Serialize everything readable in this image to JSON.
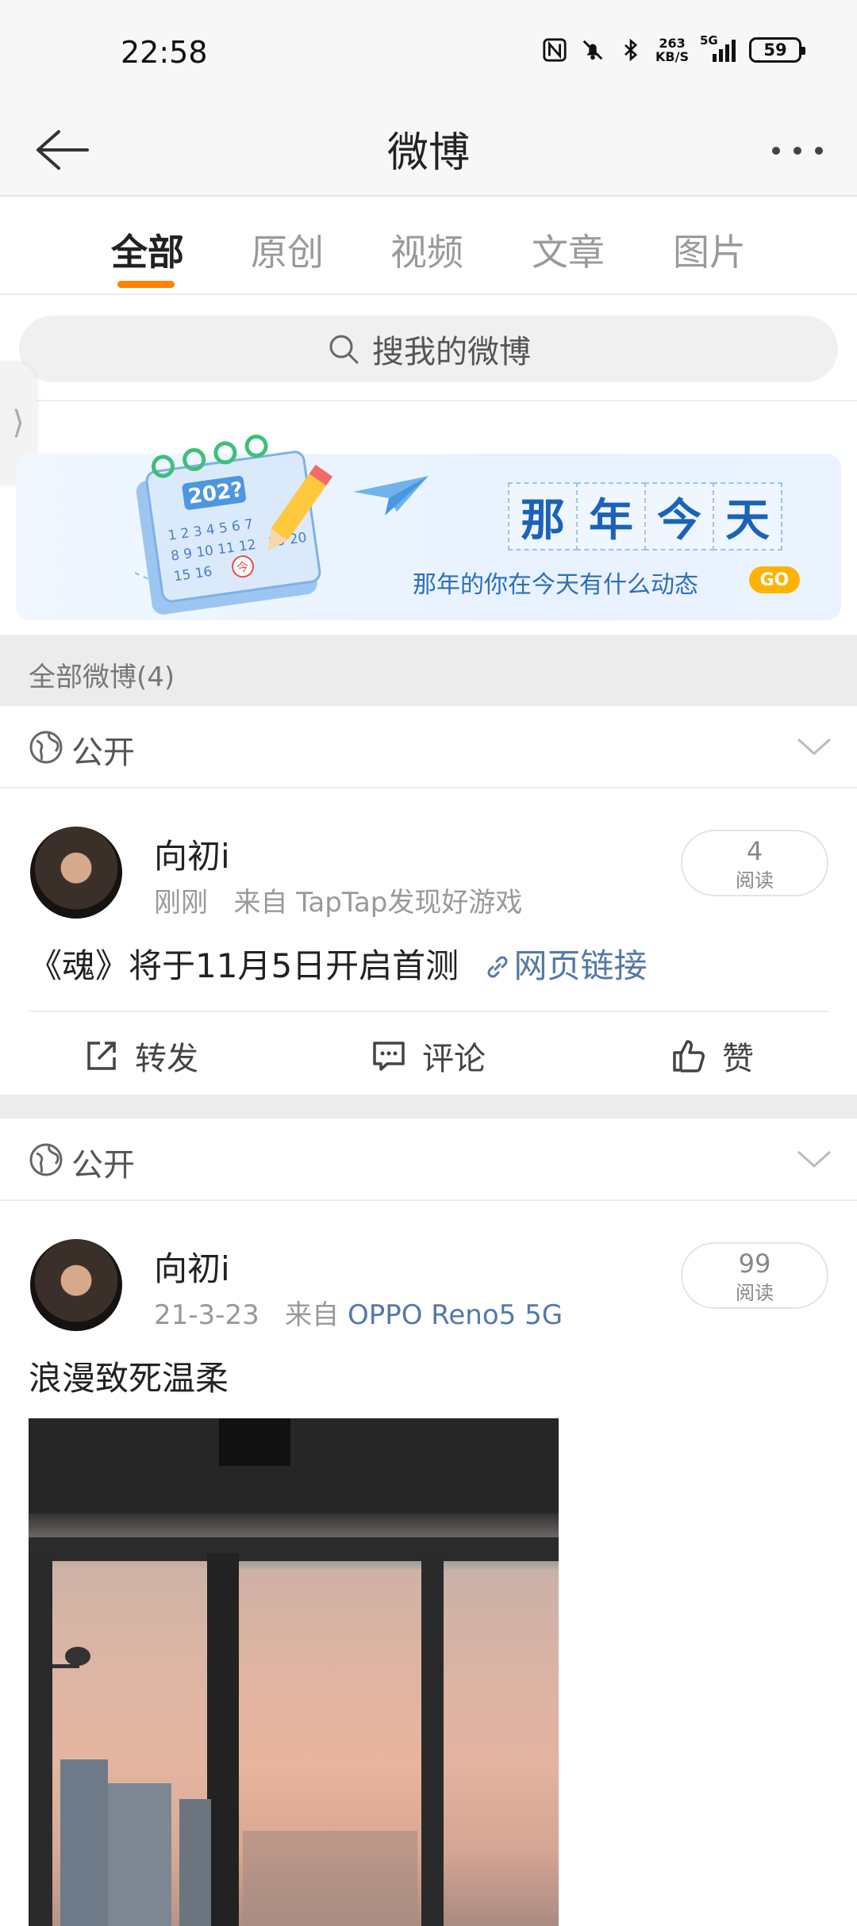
{
  "status": {
    "time": "22:58",
    "net_speed_value": "263",
    "net_speed_unit": "KB/S",
    "network": "5G",
    "battery": "59"
  },
  "header": {
    "title": "微博"
  },
  "tabs": [
    {
      "label": "全部",
      "active": true
    },
    {
      "label": "原创",
      "active": false
    },
    {
      "label": "视频",
      "active": false
    },
    {
      "label": "文章",
      "active": false
    },
    {
      "label": "图片",
      "active": false
    }
  ],
  "search": {
    "placeholder": "搜我的微博"
  },
  "banner": {
    "title_chars": [
      "那",
      "年",
      "今",
      "天"
    ],
    "subtitle": "那年的你在今天有什么动态",
    "go": "GO",
    "calendar_year": "202?"
  },
  "feed": {
    "section_title": "全部微博(4)",
    "posts": [
      {
        "visibility": "公开",
        "user": "向初i",
        "time": "刚刚",
        "source_prefix": "来自",
        "source": "TapTap发现好游戏",
        "reads": "4",
        "reads_label": "阅读",
        "text": "《魂》将于11月5日开启首测",
        "link_text": "网页链接",
        "actions": {
          "repost": "转发",
          "comment": "评论",
          "like": "赞"
        }
      },
      {
        "visibility": "公开",
        "user": "向初i",
        "time": "21-3-23",
        "source_prefix": "来自",
        "source": "OPPO Reno5 5G",
        "reads": "99",
        "reads_label": "阅读",
        "text": "浪漫致死温柔"
      }
    ]
  },
  "colors": {
    "accent": "#ff8200",
    "link": "#5479a7",
    "banner_blue": "#1b63b8",
    "go_badge": "#ffb300"
  }
}
